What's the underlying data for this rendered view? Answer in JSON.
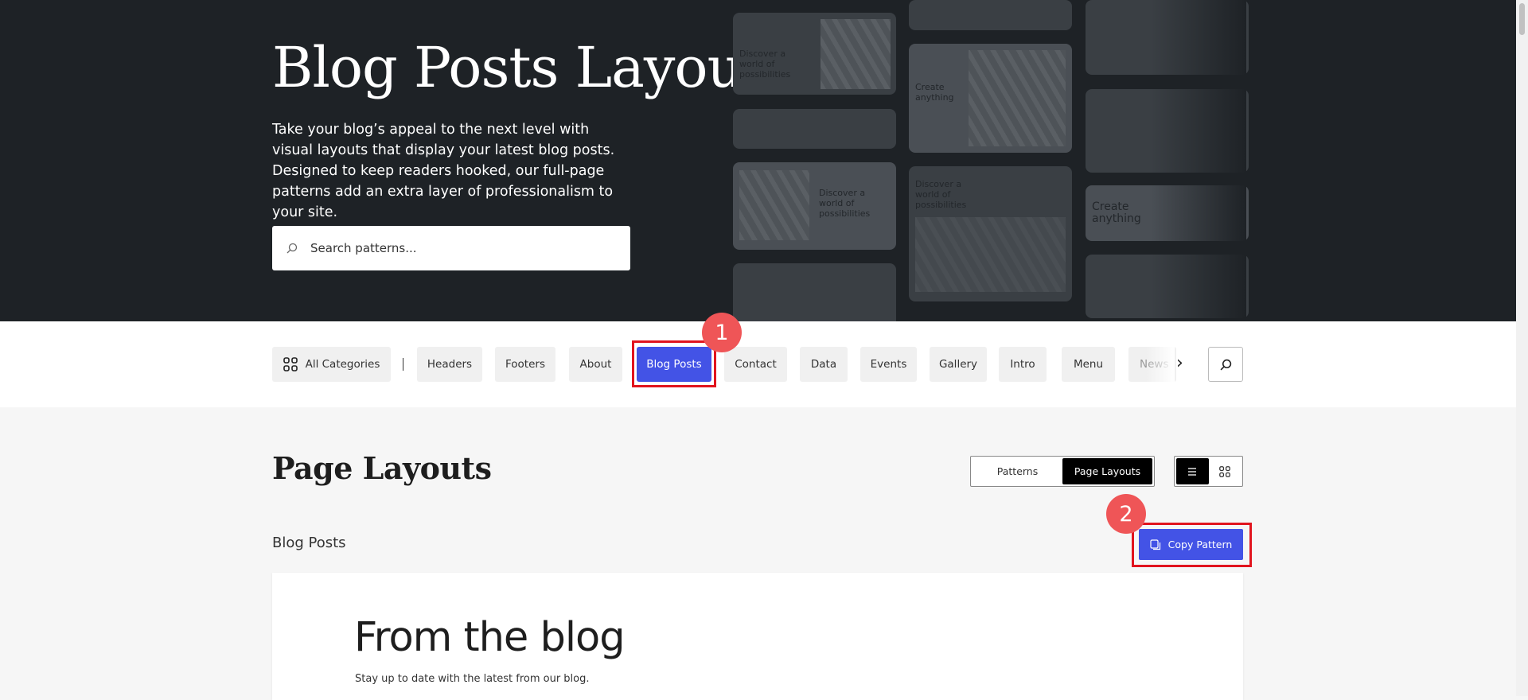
{
  "hero": {
    "title": "Blog Posts Layouts",
    "description": "Take your blog’s appeal to the next level with visual layouts that display your latest blog posts. Designed to keep readers hooked, our full-page patterns add an extra layer of professionalism to your site.",
    "search_placeholder": "Search patterns...",
    "preview_texts": {
      "discover": "Discover a world of possibilities",
      "create": "Create anything"
    }
  },
  "categories": {
    "all_label": "All Categories",
    "items": [
      "Headers",
      "Footers",
      "About",
      "Blog Posts",
      "Contact",
      "Data",
      "Events",
      "Gallery",
      "Intro",
      "Menu",
      "News"
    ],
    "active": "Blog Posts"
  },
  "main": {
    "title": "Page Layouts",
    "toggle": [
      "Patterns",
      "Page Layouts"
    ],
    "toggle_active": "Page Layouts",
    "view_active": "list",
    "section_label": "Blog Posts",
    "copy_button": "Copy Pattern"
  },
  "preview": {
    "heading": "From the blog",
    "subtext": "Stay up to date with the latest from our blog."
  },
  "annotations": [
    "1",
    "2"
  ],
  "colors": {
    "accent": "#4353e6",
    "hero_bg": "#1e2226",
    "annotation": "#ef5557"
  }
}
